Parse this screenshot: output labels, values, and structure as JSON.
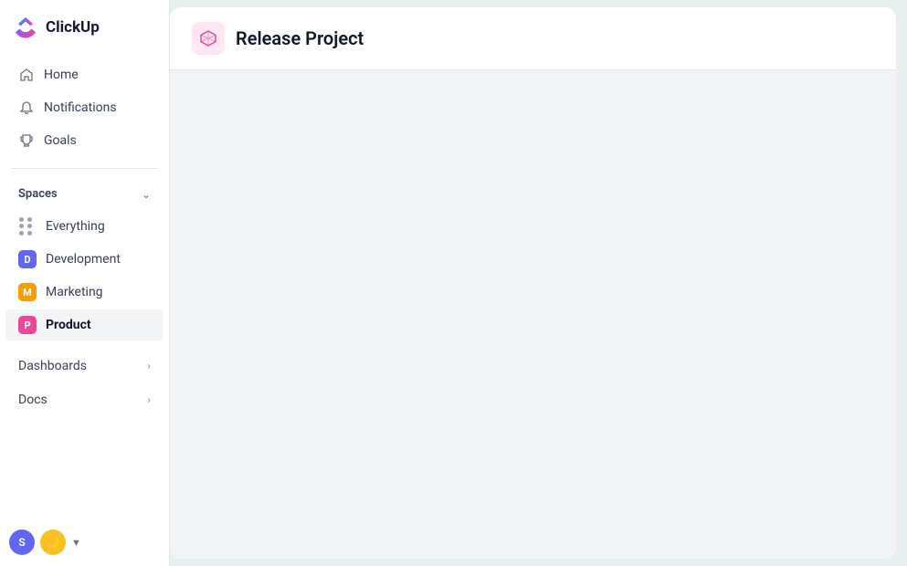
{
  "app": {
    "name": "ClickUp"
  },
  "sidebar": {
    "nav_items": [
      {
        "id": "home",
        "label": "Home",
        "icon": "home-icon"
      },
      {
        "id": "notifications",
        "label": "Notifications",
        "icon": "bell-icon"
      },
      {
        "id": "goals",
        "label": "Goals",
        "icon": "trophy-icon"
      }
    ],
    "spaces_section": {
      "label": "Spaces",
      "chevron": "chevron-down"
    },
    "spaces": [
      {
        "id": "everything",
        "label": "Everything",
        "type": "dots"
      },
      {
        "id": "development",
        "label": "Development",
        "color": "#6366f1",
        "letter": "D"
      },
      {
        "id": "marketing",
        "label": "Marketing",
        "color": "#f59e0b",
        "letter": "M"
      },
      {
        "id": "product",
        "label": "Product",
        "color": "#ec4899",
        "letter": "P",
        "active": true
      }
    ],
    "bottom_items": [
      {
        "id": "dashboards",
        "label": "Dashboards"
      },
      {
        "id": "docs",
        "label": "Docs"
      }
    ]
  },
  "header": {
    "project_title": "Release Project"
  }
}
